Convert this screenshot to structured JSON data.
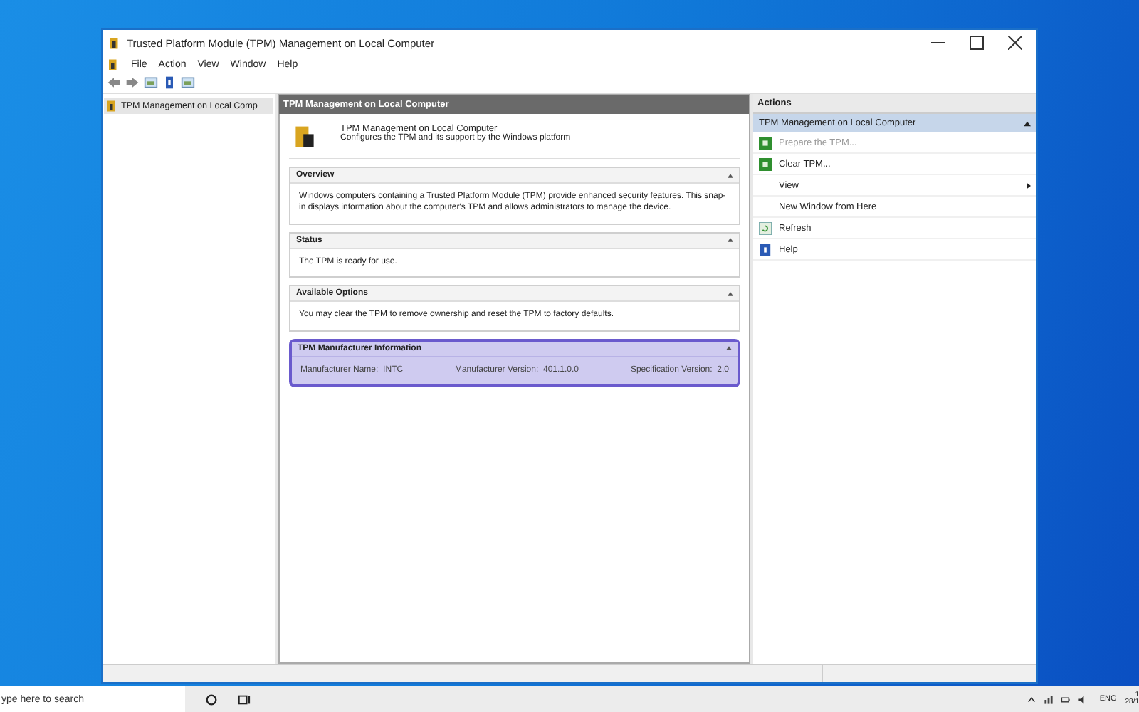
{
  "window": {
    "title": "Trusted Platform Module (TPM) Management on Local Computer"
  },
  "menu": [
    "File",
    "Action",
    "View",
    "Window",
    "Help"
  ],
  "tree": {
    "items": [
      {
        "label": "TPM Management on Local Comp",
        "selected": true
      }
    ]
  },
  "center": {
    "header": "TPM Management on Local Computer",
    "intro_title": "TPM Management on Local Computer",
    "intro_text": "Configures the TPM and its support by the Windows platform",
    "sections": [
      {
        "title": "Overview",
        "highlighted": false,
        "kind": "text",
        "text": "Windows computers containing a Trusted Platform Module (TPM) provide enhanced security features. This snap-in displays information about the computer's TPM and allows administrators to manage the device."
      },
      {
        "title": "Status",
        "highlighted": false,
        "kind": "text",
        "text": "The TPM is ready for use."
      },
      {
        "title": "Available Options",
        "highlighted": false,
        "kind": "text",
        "text": "You may clear the TPM to remove ownership and reset the TPM to factory defaults."
      },
      {
        "title": "TPM Manufacturer Information",
        "highlighted": true,
        "kind": "fields",
        "fields": [
          {
            "label": "Manufacturer Name:",
            "value": "INTC"
          },
          {
            "label": "Manufacturer Version:",
            "value": "401.1.0.0"
          },
          {
            "label": "Specification Version:",
            "value": "2.0"
          }
        ]
      }
    ]
  },
  "actions": {
    "header": "Actions",
    "group": "TPM Management on Local Computer",
    "items": [
      {
        "label": "Prepare the TPM...",
        "kind": "task",
        "disabled": true,
        "submenu": false
      },
      {
        "label": "Clear TPM...",
        "kind": "task",
        "disabled": false,
        "submenu": false
      },
      {
        "label": "View",
        "kind": "plain",
        "disabled": false,
        "submenu": true
      },
      {
        "label": "New Window from Here",
        "kind": "plain",
        "disabled": false,
        "submenu": false
      },
      {
        "label": "Refresh",
        "kind": "refresh",
        "disabled": false,
        "submenu": false
      },
      {
        "label": "Help",
        "kind": "help",
        "disabled": false,
        "submenu": false
      }
    ]
  },
  "taskbar": {
    "search_placeholder": "ype here to search",
    "language": "ENG",
    "clock_time": "1",
    "clock_date": "28/1"
  }
}
